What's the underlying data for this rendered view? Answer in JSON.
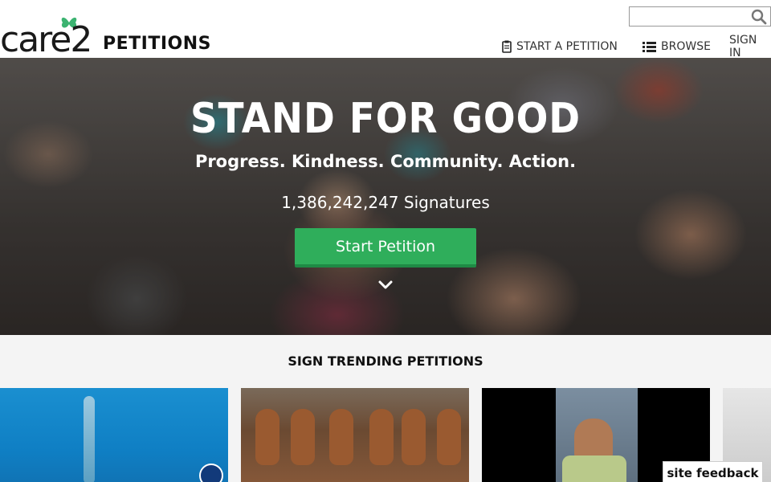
{
  "header": {
    "logo_word": "care",
    "logo_num": "2",
    "logo_suffix": "PETITIONS",
    "search_placeholder": "",
    "nav": {
      "start": "START A PETITION",
      "browse": "BROWSE",
      "signin": "SIGN IN"
    }
  },
  "hero": {
    "title": "STAND FOR GOOD",
    "subtitle": "Progress. Kindness. Community. Action.",
    "signatures": "1,386,242,247 Signatures",
    "cta": "Start Petition"
  },
  "trending": {
    "title": "SIGN TRENDING PETITIONS"
  },
  "feedback": "site feedback",
  "colors": {
    "accent_green": "#2fae5b",
    "logo_green": "#3cb371"
  },
  "icons": {
    "search": "search-icon",
    "clipboard": "clipboard-icon",
    "list": "list-icon",
    "chevron": "chevron-down-icon"
  }
}
